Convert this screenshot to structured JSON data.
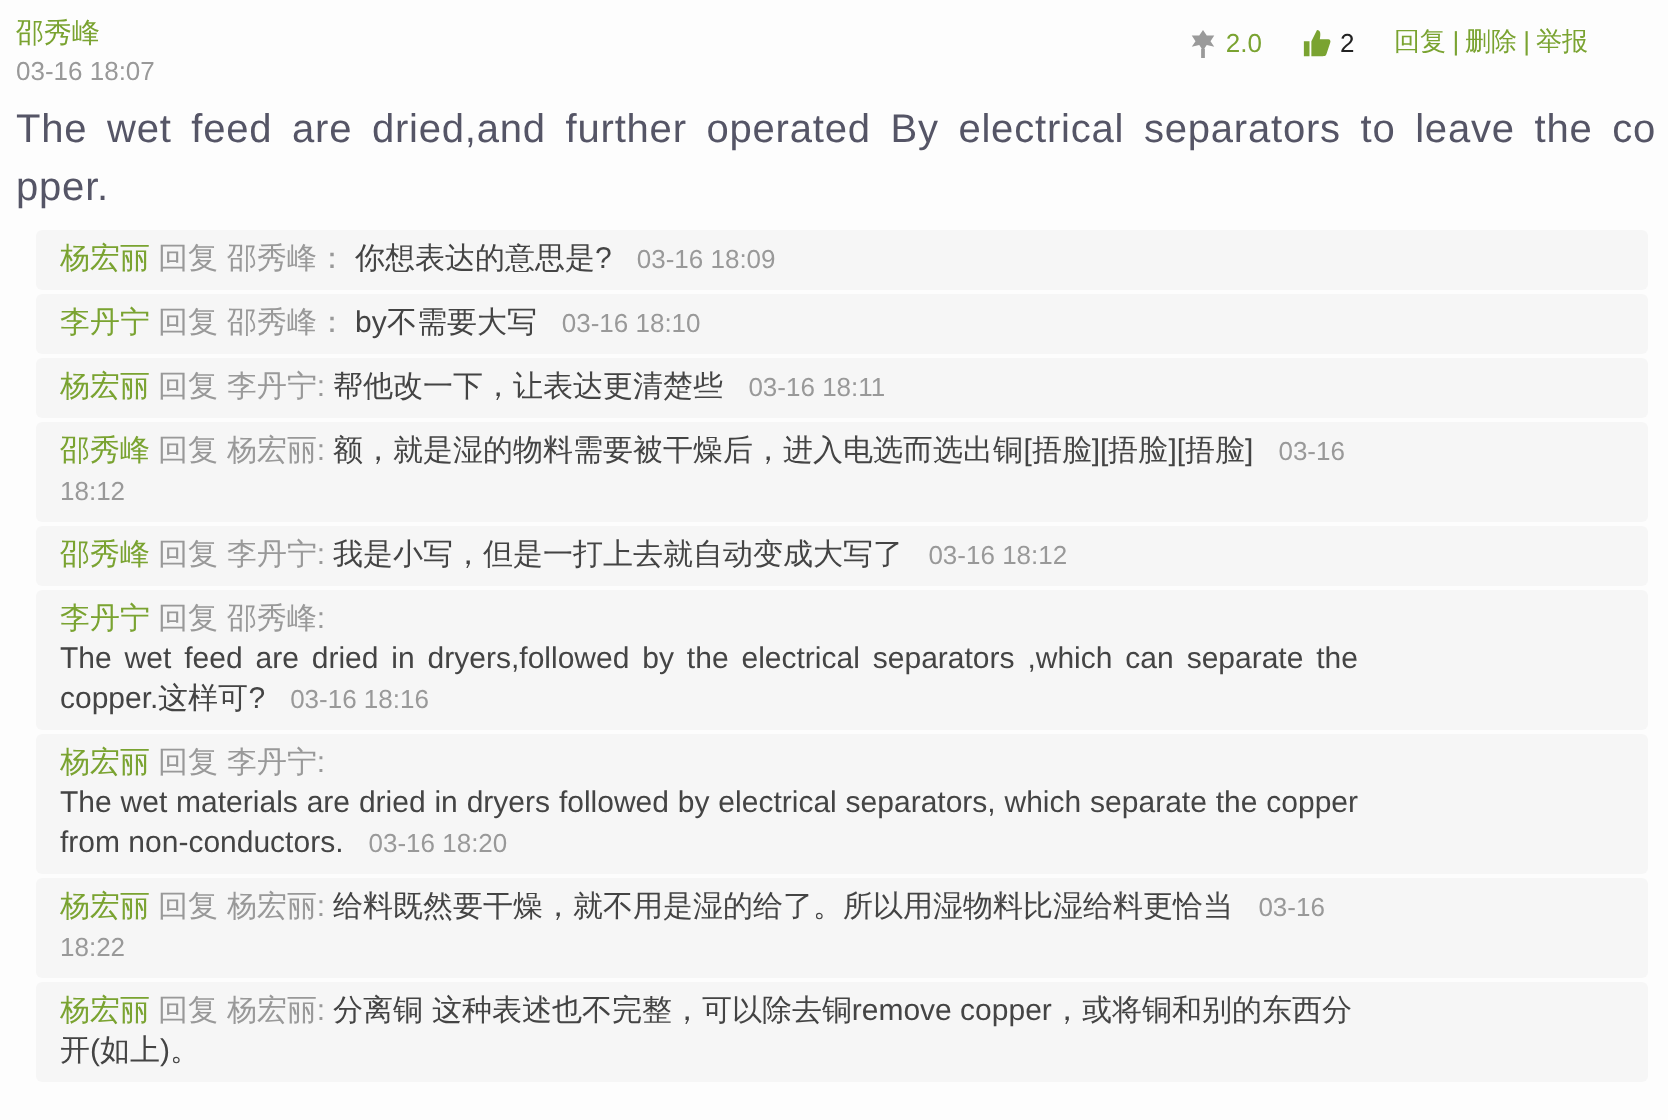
{
  "post": {
    "author": "邵秀峰",
    "time": "03-16 18:07",
    "score": "2.0",
    "likes": "2",
    "actions": [
      "回复",
      "删除",
      "举报"
    ],
    "separator": "|",
    "text": "The wet feed are dried,and further operated By electrical separators to leave the copper."
  },
  "replies": [
    {
      "kind": "inline",
      "author": "杨宏丽",
      "verb": "回复",
      "target": "邵秀峰：",
      "text": "你想表达的意思是?",
      "time": "03-16 18:09"
    },
    {
      "kind": "inline",
      "author": "李丹宁",
      "verb": "回复",
      "target": "邵秀峰：",
      "text": "by不需要大写",
      "time": "03-16 18:10"
    },
    {
      "kind": "inline",
      "author": "杨宏丽",
      "verb": "回复",
      "target": "李丹宁:",
      "text": "帮他改一下，让表达更清楚些",
      "time": "03-16 18:11"
    },
    {
      "kind": "inline",
      "author": "邵秀峰",
      "verb": "回复",
      "target": "杨宏丽:",
      "text": "额，就是湿的物料需要被干燥后，进入电选而选出铜[捂脸][捂脸][捂脸]",
      "time": "03-16 18:12"
    },
    {
      "kind": "inline",
      "author": "邵秀峰",
      "verb": "回复",
      "target": "李丹宁:",
      "text": "我是小写，但是一打上去就自动变成大写了",
      "time": "03-16 18:12"
    },
    {
      "kind": "block",
      "author": "李丹宁",
      "verb": "回复",
      "target": "邵秀峰:",
      "text": "The wet feed are dried in dryers,followed by the electrical separators ,which can separate the copper.这样可?",
      "time": "03-16 18:16"
    },
    {
      "kind": "block",
      "author": "杨宏丽",
      "verb": "回复",
      "target": "李丹宁:",
      "text": "The wet materials are dried in dryers followed by electrical separators, which separate the copper from non-conductors.",
      "time": "03-16 18:20"
    },
    {
      "kind": "inline",
      "author": "杨宏丽",
      "verb": "回复",
      "target": "杨宏丽:",
      "text": "给料既然要干燥，就不用是湿的给了。所以用湿物料比湿给料更恰当",
      "time": "03-16 18:22"
    },
    {
      "kind": "inline",
      "author": "杨宏丽",
      "verb": "回复",
      "target": "杨宏丽:",
      "text": "分离铜 这种表述也不完整，可以除去铜remove copper，或将铜和别的东西分开(如上)。"
    }
  ]
}
